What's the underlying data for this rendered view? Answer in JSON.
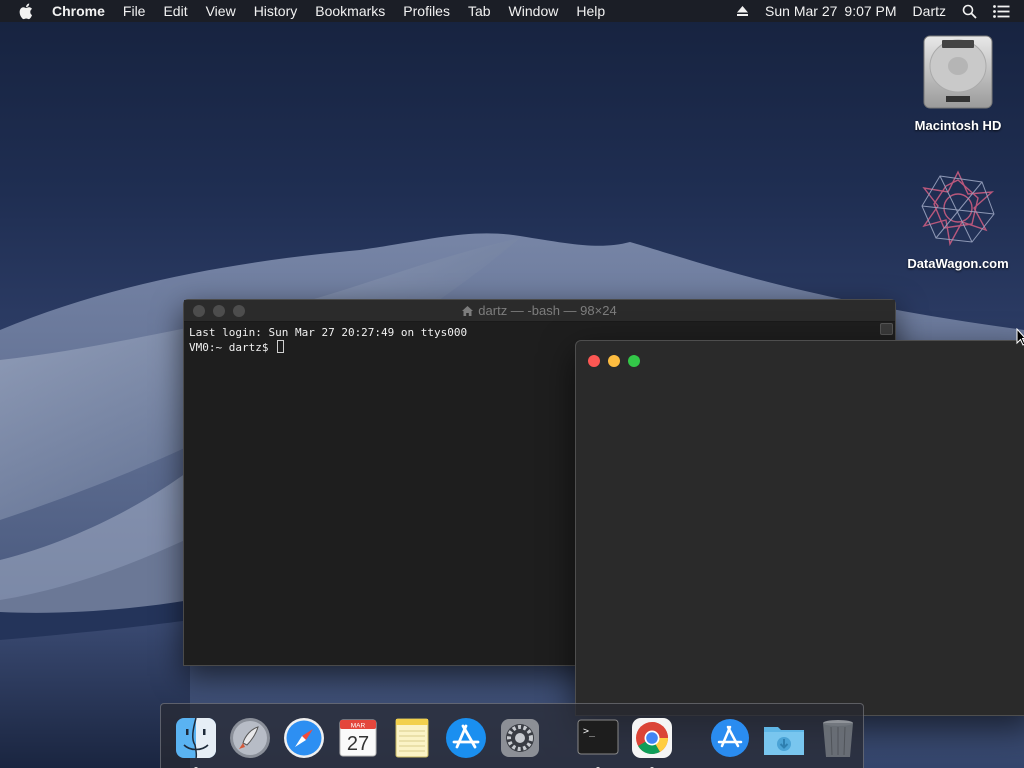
{
  "menubar": {
    "app": "Chrome",
    "items": [
      "File",
      "Edit",
      "View",
      "History",
      "Bookmarks",
      "Profiles",
      "Tab",
      "Window",
      "Help"
    ],
    "date": "Sun Mar 27",
    "time": "9:07 PM",
    "user": "Dartz"
  },
  "desktop": {
    "icons": [
      {
        "label": "Macintosh HD",
        "icon": "hard-drive-icon"
      },
      {
        "label": "DataWagon.com",
        "icon": "datawagon-logo-icon"
      }
    ]
  },
  "terminal": {
    "title": "dartz — -bash — 98×24",
    "lines": [
      "Last login: Sun Mar 27 20:27:49 on ttys000",
      "VM0:~ dartz$ "
    ]
  },
  "dock": {
    "calendar_month": "MAR",
    "calendar_day": "27",
    "terminal_prompt": ">_",
    "items": [
      {
        "app": "Finder",
        "icon": "finder-icon",
        "running": true
      },
      {
        "app": "Launchpad",
        "icon": "launchpad-icon",
        "running": false
      },
      {
        "app": "Safari",
        "icon": "safari-icon",
        "running": false
      },
      {
        "app": "Calendar",
        "icon": "calendar-icon",
        "running": false
      },
      {
        "app": "Notes",
        "icon": "notes-icon",
        "running": false
      },
      {
        "app": "App Store",
        "icon": "app-store-icon",
        "running": false
      },
      {
        "app": "System Preferences",
        "icon": "system-preferences-icon",
        "running": false
      },
      {
        "app": "Terminal",
        "icon": "terminal-icon",
        "running": true
      },
      {
        "app": "Google Chrome",
        "icon": "chrome-icon",
        "running": true
      },
      {
        "app": "Applications",
        "icon": "applications-folder-icon",
        "running": false
      },
      {
        "app": "Downloads",
        "icon": "downloads-folder-icon",
        "running": false
      },
      {
        "app": "Trash",
        "icon": "trash-icon",
        "running": false
      }
    ]
  },
  "colors": {
    "close": "#fc5753",
    "minimize": "#fdbc40",
    "zoom": "#33c748"
  }
}
